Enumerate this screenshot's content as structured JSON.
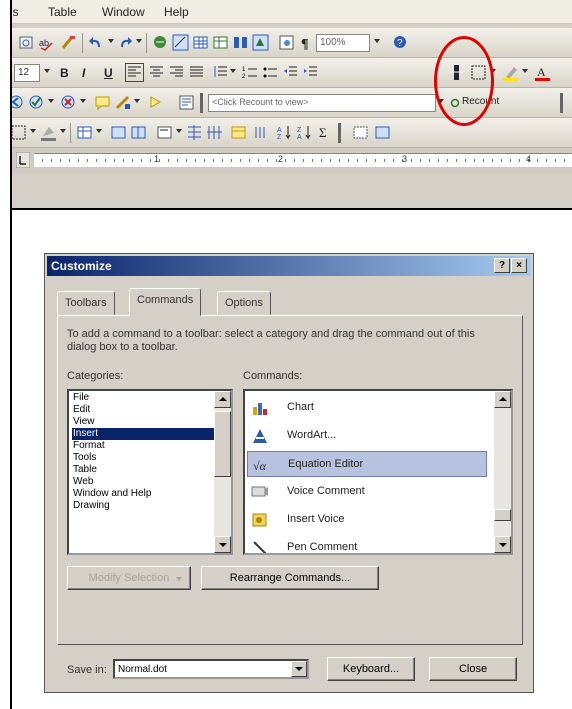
{
  "menu": {
    "items": [
      "ls",
      "Table",
      "Window",
      "Help"
    ]
  },
  "toolbar": {
    "zoom_value": "100%",
    "font_size": "12",
    "bold_label": "B",
    "italic_label": "I",
    "underline_label": "U",
    "recount_field": "<Click Recount to view>",
    "recount_button": "Recount"
  },
  "ruler": {
    "numbers": [
      "1",
      "2",
      "3",
      "4"
    ]
  },
  "dialog": {
    "title": "Customize",
    "help_button": "?",
    "close_button": "×",
    "tabs": [
      "Toolbars",
      "Commands",
      "Options"
    ],
    "active_tab": "Commands",
    "instructions": "To add a command to a toolbar: select a category and drag the command out of this dialog box to a toolbar.",
    "categories_label": "Categories:",
    "commands_label": "Commands:",
    "categories": [
      "File",
      "Edit",
      "View",
      "Insert",
      "Format",
      "Tools",
      "Table",
      "Web",
      "Window and Help",
      "Drawing"
    ],
    "selected_category": "Insert",
    "commands": [
      {
        "label": "Chart",
        "icon": "chart-icon"
      },
      {
        "label": "WordArt...",
        "icon": "wordart-icon"
      },
      {
        "label": "Equation Editor",
        "icon": "equation-editor-icon"
      },
      {
        "label": "Voice Comment",
        "icon": "voice-comment-icon"
      },
      {
        "label": "Insert Voice",
        "icon": "insert-voice-icon"
      },
      {
        "label": "Pen Comment",
        "icon": "pen-comment-icon"
      }
    ],
    "selected_command": "Equation Editor",
    "modify_selection_button": "Modify Selection",
    "rearrange_button": "Rearrange Commands...",
    "save_in_label": "Save in:",
    "save_in_value": "Normal.dot",
    "keyboard_button": "Keyboard...",
    "close_text_button": "Close"
  },
  "colors": {
    "title_bar_start": "#0a246a",
    "title_bar_end": "#a6caf0",
    "selection": "#0a246a",
    "command_selection": "#b7c3de",
    "highlight_circle": "#e10000"
  }
}
